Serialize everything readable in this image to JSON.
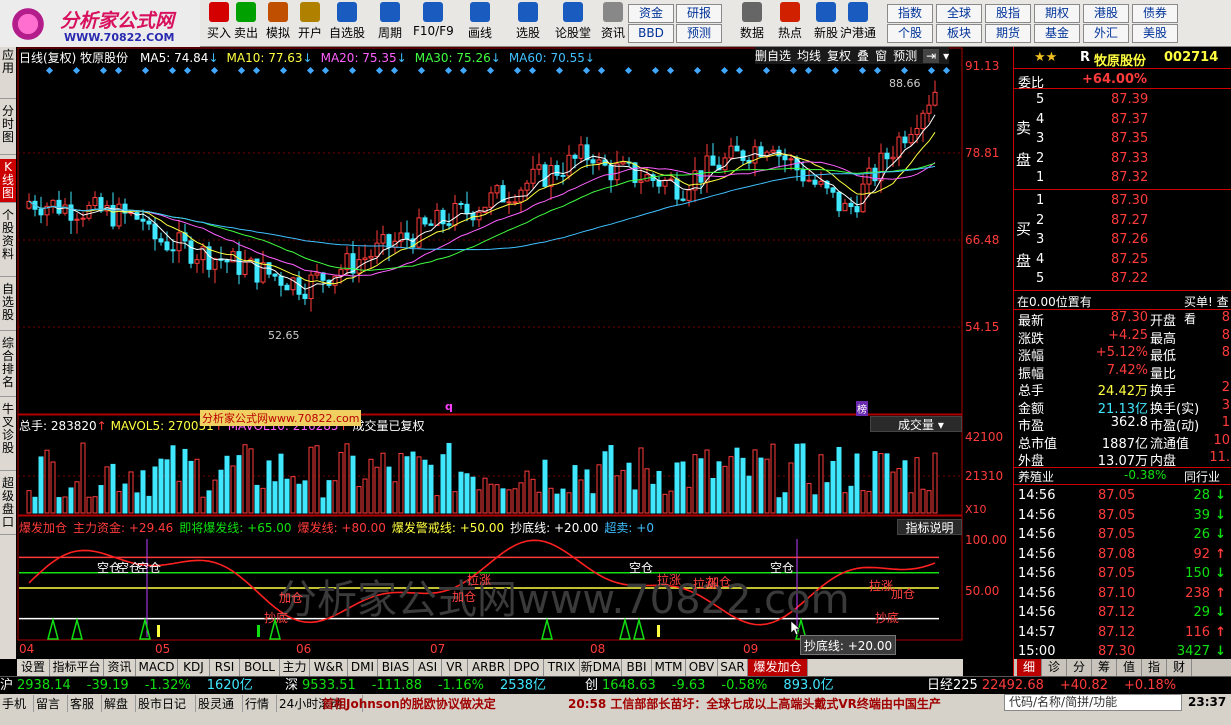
{
  "logo": {
    "title": "分析家公式网",
    "url": "WWW.70822.COM"
  },
  "toolbar": {
    "buttons": [
      {
        "label": "买入",
        "icon": "buy-icon",
        "color": "#d40000"
      },
      {
        "label": "卖出",
        "icon": "sell-icon",
        "color": "#00a000"
      },
      {
        "label": "模拟",
        "icon": "gavel-icon",
        "color": "#c05000"
      },
      {
        "label": "开户",
        "icon": "lock-icon",
        "color": "#b08000"
      },
      {
        "label": "自选股",
        "icon": "star-icon",
        "color": "#1a5bbf"
      },
      {
        "label": "周期",
        "icon": "clock-icon",
        "color": "#1a5bbf"
      },
      {
        "label": "F10/F9",
        "icon": "f10-icon",
        "color": "#1a5bbf"
      },
      {
        "label": "画线",
        "icon": "pen-icon",
        "color": "#1a5bbf"
      },
      {
        "label": "选股",
        "icon": "monitor-icon",
        "color": "#1a5bbf"
      },
      {
        "label": "论股堂",
        "icon": "forum-icon",
        "color": "#1a5bbf"
      },
      {
        "label": "资讯",
        "icon": "document-icon",
        "color": "#888888"
      },
      {
        "label": "数据",
        "icon": "pe-icon",
        "color": "#666666"
      },
      {
        "label": "热点",
        "icon": "fire-icon",
        "color": "#d02000"
      },
      {
        "label": "新股",
        "icon": "ipo-icon",
        "color": "#1a5bbf"
      },
      {
        "label": "沪港通",
        "icon": "hk-connect-icon",
        "color": "#1a5bbf"
      }
    ],
    "small": [
      {
        "label": "资金"
      },
      {
        "label": "研报"
      },
      {
        "label": "BBD"
      },
      {
        "label": "预测"
      },
      {
        "label": "指数"
      },
      {
        "label": "全球"
      },
      {
        "label": "股指"
      },
      {
        "label": "期权"
      },
      {
        "label": "港股"
      },
      {
        "label": "债券"
      },
      {
        "label": "个股"
      },
      {
        "label": "板块"
      },
      {
        "label": "期货"
      },
      {
        "label": "基金"
      },
      {
        "label": "外汇"
      },
      {
        "label": "美股"
      }
    ]
  },
  "leftnav": [
    {
      "label": "应用"
    },
    {
      "label": "分时图"
    },
    {
      "label": "K线图",
      "active": true
    },
    {
      "label": "个股资料"
    },
    {
      "label": "自选股"
    },
    {
      "label": "综合排名"
    },
    {
      "label": "牛叉诊股"
    },
    {
      "label": "超级盘口"
    }
  ],
  "main_chart": {
    "header_title": "日线(复权) 牧原股份",
    "ma": [
      {
        "label": "MA5: 74.84",
        "color": "#ffffff"
      },
      {
        "label": "MA10: 77.63",
        "color": "#ffff40"
      },
      {
        "label": "MA20: 75.35",
        "color": "#ff60ff"
      },
      {
        "label": "MA30: 75.26",
        "color": "#40ff40"
      },
      {
        "label": "MA60: 70.55",
        "color": "#40c0ff"
      }
    ],
    "tools": [
      "删自选",
      "均线",
      "复权",
      "叠",
      "窗",
      "预测"
    ],
    "y_ticks": [
      "91.13",
      "78.81",
      "66.48",
      "54.15"
    ],
    "high_label": "88.66",
    "low_label": "52.65",
    "marker_q": "q",
    "marker_bang": "榜"
  },
  "volume_panel": {
    "label_total": "总手: 283820",
    "label_mavol5": "MAVOL5: 270051",
    "label_mavol10": "MAVOL10: 216285",
    "label_fq": "成交量已复权",
    "selector": "成交量",
    "y_ticks": [
      "42100",
      "21310"
    ],
    "y_unit": "X10",
    "watermark": "分析家公式网www.70822.com"
  },
  "indicator_panel": {
    "labels": [
      {
        "text": "爆发加仓",
        "color": "#ff3b3b"
      },
      {
        "text": "主力资金: +29.46",
        "color": "#ff3b3b"
      },
      {
        "text": "即将爆发线: +65.00",
        "color": "#10e010"
      },
      {
        "text": "爆发线: +80.00",
        "color": "#ff3b3b"
      },
      {
        "text": "爆发警戒线: +50.00",
        "color": "#ffff40"
      },
      {
        "text": "抄底线: +20.00",
        "color": "#ffffff"
      },
      {
        "text": "超卖: +0",
        "color": "#40c0ff"
      }
    ],
    "help": "指标说明",
    "y_ticks": [
      "100.00",
      "50.00"
    ],
    "watermark": "分析家公式网www.70822.com",
    "tooltip": "抄底线: +20.00",
    "annotations": [
      "空仓",
      "空仓",
      "空仓",
      "拉涨",
      "加仓",
      "抄底",
      "加仓",
      "空仓",
      "拉涨",
      "拉涨",
      "加仓",
      "空仓",
      "拉涨",
      "抄底",
      "加仓"
    ]
  },
  "x_ticks": [
    "04",
    "05",
    "06",
    "07",
    "08",
    "09"
  ],
  "bottom_tabs": [
    "设置",
    "指标平台",
    "资讯",
    "MACD",
    "KDJ",
    "RSI",
    "BOLL",
    "主力",
    "W&R",
    "DMI",
    "BIAS",
    "ASI",
    "VR",
    "ARBR",
    "DPO",
    "TRIX",
    "新DMA",
    "BBI",
    "MTM",
    "OBV",
    "SAR",
    "爆发加仓"
  ],
  "stock": {
    "flag": "R",
    "name": "牧原股份",
    "code": "002714",
    "weibi_label": "委比",
    "weibi": "+64.00%"
  },
  "orderbook": {
    "sell_label": "卖",
    "sell_label2": "盘",
    "buy_label": "买",
    "buy_label2": "盘",
    "sell": [
      {
        "n": "5",
        "p": "87.39"
      },
      {
        "n": "4",
        "p": "87.37"
      },
      {
        "n": "3",
        "p": "87.35"
      },
      {
        "n": "2",
        "p": "87.33"
      },
      {
        "n": "1",
        "p": "87.32"
      }
    ],
    "buy": [
      {
        "n": "1",
        "p": "87.30"
      },
      {
        "n": "2",
        "p": "87.27"
      },
      {
        "n": "3",
        "p": "87.26"
      },
      {
        "n": "4",
        "p": "87.25"
      },
      {
        "n": "5",
        "p": "87.22"
      }
    ]
  },
  "position_row": {
    "left": "在0.00位置有",
    "right": "买单! 查看"
  },
  "quote": [
    {
      "k": "最新",
      "v": "87.30",
      "k2": "开盘",
      "v2": "8"
    },
    {
      "k": "涨跌",
      "v": "+4.25",
      "k2": "最高",
      "v2": "8"
    },
    {
      "k": "涨幅",
      "v": "+5.12%",
      "k2": "最低",
      "v2": "8"
    },
    {
      "k": "振幅",
      "v": "7.42%",
      "k2": "量比",
      "v2": ""
    },
    {
      "k": "总手",
      "v": "24.42万",
      "k2": "换手",
      "v2": "2"
    },
    {
      "k": "金额",
      "v": "21.13亿",
      "k2": "换手(实)",
      "v2": "3"
    },
    {
      "k": "市盈",
      "v": "362.8",
      "k2": "市盈(动)",
      "v2": "1"
    },
    {
      "k": "总市值",
      "v": "1887亿",
      "k2": "流通值",
      "v2": "10"
    },
    {
      "k": "外盘",
      "v": "13.07万",
      "k2": "内盘",
      "v2": "11."
    }
  ],
  "sector": {
    "name": "养殖业",
    "chg": "-0.38%",
    "more": "同行业"
  },
  "ticks": [
    {
      "t": "14:56",
      "p": "87.05",
      "v": "28"
    },
    {
      "t": "14:56",
      "p": "87.05",
      "v": "39"
    },
    {
      "t": "14:56",
      "p": "87.05",
      "v": "26"
    },
    {
      "t": "14:56",
      "p": "87.08",
      "v": "92"
    },
    {
      "t": "14:56",
      "p": "87.05",
      "v": "150"
    },
    {
      "t": "14:56",
      "p": "87.10",
      "v": "238"
    },
    {
      "t": "14:56",
      "p": "87.12",
      "v": "29"
    },
    {
      "t": "14:57",
      "p": "87.12",
      "v": "116"
    },
    {
      "t": "15:00",
      "p": "87.30",
      "v": "3427"
    }
  ],
  "tick_dirs": [
    "down",
    "down",
    "down",
    "up",
    "down",
    "up",
    "down",
    "up",
    "down"
  ],
  "right_tabs": [
    "细",
    "诊",
    "分",
    "筹",
    "值",
    "指",
    "财"
  ],
  "indexbar": [
    {
      "name": "沪",
      "val": "2938.14",
      "chg": "-39.19",
      "pct": "-1.32%",
      "amt": "1620亿"
    },
    {
      "name": "深",
      "val": "9533.51",
      "chg": "-111.88",
      "pct": "-1.16%",
      "amt": "2538亿"
    },
    {
      "name": "创",
      "val": "1648.63",
      "chg": "-9.63",
      "pct": "-0.58%",
      "amt": "893.0亿"
    },
    {
      "name": "日经225",
      "val": "22492.68",
      "chg": "+40.82",
      "pct": "+0.18%",
      "amt": ""
    }
  ],
  "statusbar": {
    "items": [
      "手机",
      "留言",
      "客服",
      "解盘",
      "股市日记",
      "股灵通",
      "行情",
      "24小时滚动"
    ],
    "news1": "首相Johnson的脱欧协议做决定",
    "news2": "20:58 工信部部长苗圩：全球七成以上高端头戴式VR终端由中国生产",
    "search": "代码/名称/简拼/功能",
    "time": "23:37"
  }
}
